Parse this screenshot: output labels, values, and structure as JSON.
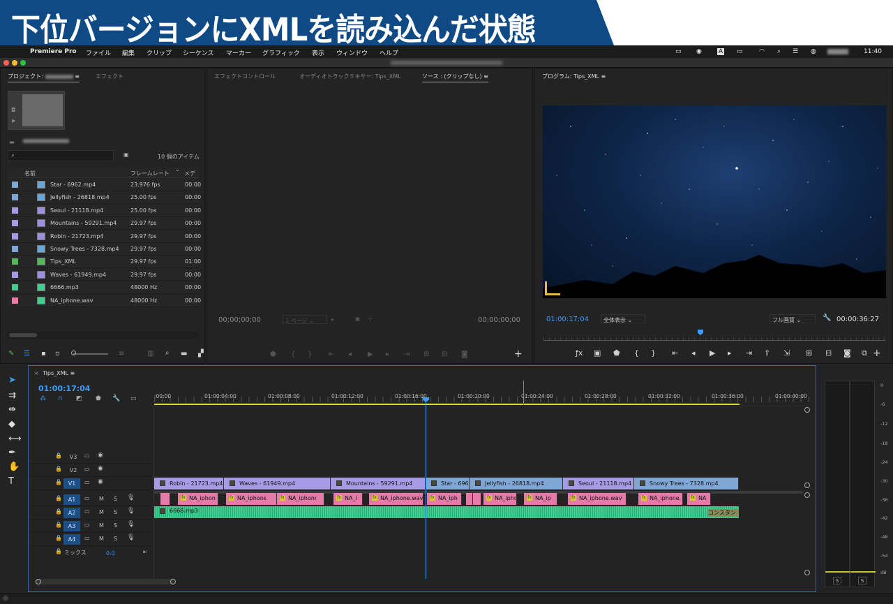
{
  "banner": {
    "title": "下位バージョンにXMLを読み込んだ状態"
  },
  "menubar": {
    "app": "Premiere Pro",
    "items": [
      "ファイル",
      "編集",
      "クリップ",
      "シーケンス",
      "マーカー",
      "グラフィック",
      "表示",
      "ウィンドウ",
      "ヘルプ"
    ],
    "clock": "11:40"
  },
  "project_panel": {
    "tab_project": "プロジェクト:",
    "tab_effects": "エフェクト",
    "item_count": "10 個のアイテム",
    "col_name": "名前",
    "col_framerate": "フレームレート",
    "col_media": "メディ",
    "items": [
      {
        "name": "Star - 6962.mp4",
        "fps": "23.976 fps",
        "start": "00:00",
        "color": "#7fa6d4",
        "icon": "#68a6d8"
      },
      {
        "name": "Jellyfish - 26818.mp4",
        "fps": "25.00 fps",
        "start": "00:00",
        "color": "#7fa6d4",
        "icon": "#68a6d8"
      },
      {
        "name": "Seoul - 21118.mp4",
        "fps": "25.00 fps",
        "start": "00:00",
        "color": "#a79be6",
        "icon": "#9c8fe0"
      },
      {
        "name": "Mountains - 59291.mp4",
        "fps": "29.97 fps",
        "start": "00:00",
        "color": "#a79be6",
        "icon": "#9c8fe0"
      },
      {
        "name": "Robin - 21723.mp4",
        "fps": "29.97 fps",
        "start": "00:00",
        "color": "#a79be6",
        "icon": "#9c8fe0"
      },
      {
        "name": "Snowy Trees - 7328.mp4",
        "fps": "29.97 fps",
        "start": "00:00",
        "color": "#7fa6d4",
        "icon": "#68a6d8"
      },
      {
        "name": "Tips_XML",
        "fps": "29.97 fps",
        "start": "01:00",
        "color": "#4fb85a",
        "icon": "#4fb85a"
      },
      {
        "name": "Waves - 61949.mp4",
        "fps": "29.97 fps",
        "start": "00:00",
        "color": "#a79be6",
        "icon": "#9c8fe0"
      },
      {
        "name": "6666.mp3",
        "fps": "48000 Hz",
        "start": "00:00",
        "color": "#3fcf8e",
        "icon": "#3fcf8e"
      },
      {
        "name": "NA_iphone.wav",
        "fps": "48000 Hz",
        "start": "00:00",
        "color": "#ee7aa8",
        "icon": "#3fcf8e"
      }
    ]
  },
  "source_panel": {
    "tab_effect_controls": "エフェクトコントロール",
    "tab_audio_mixer": "オーディオトラックミキサー: Tips_XML",
    "tab_source": "ソース : (クリップなし)",
    "tc_left": "00;00;00;00",
    "page": "1 ページ",
    "tc_right": "00;00;00;00"
  },
  "program_panel": {
    "tab": "プログラム: Tips_XML",
    "tc_current": "01:00:17:04",
    "zoom": "全体表示",
    "quality": "フル画質",
    "duration": "00:00:36:27"
  },
  "timeline": {
    "tab": "Tips_XML",
    "tc": "01:00:17:04",
    "ruler": [
      ":00:00",
      "01:00:04:00",
      "01:00:08:00",
      "01:00:12:00",
      "01:00:16:00",
      "01:00:20:00",
      "01:00:24:00",
      "01:00:28:00",
      "01:00:32:00",
      "01:00:36:00",
      "01:00:40:00"
    ],
    "video_tracks": [
      "V3",
      "V2",
      "V1"
    ],
    "audio_tracks": [
      "A1",
      "A2",
      "A3",
      "A4"
    ],
    "mix_label": "ミックス",
    "mix_value": "0.0",
    "v1_clips": [
      {
        "name": "Robin - 21723.mp4",
        "color": "#a79be6"
      },
      {
        "name": "Waves - 61949.mp4",
        "color": "#a79be6"
      },
      {
        "name": "Mountains - 59291.mp4",
        "color": "#a79be6"
      },
      {
        "name": "Star - 6962.",
        "color": "#7fa6d4"
      },
      {
        "name": "Jellyfish - 26818.mp4",
        "color": "#7fa6d4"
      },
      {
        "name": "Seoul - 21118.mp4",
        "color": "#a79be6"
      },
      {
        "name": "Snowy Trees - 7328.mp4",
        "color": "#7fa6d4"
      }
    ],
    "a1_clips": [
      "NA_iphon",
      "NA_iphone.",
      "NA_iphone.",
      "NA_i",
      "NA_iphone.wav",
      "NA_iph",
      "NA_ipho",
      "NA_ip",
      "NA_iphone.wav",
      "NA_iphone.",
      "NA"
    ],
    "a2_clip": "6666.mp3",
    "a2_tail": "コンスタン"
  },
  "meter": {
    "labels": [
      "0",
      "-6",
      "-12",
      "-18",
      "-24",
      "-30",
      "-36",
      "-42",
      "-48",
      "-54",
      "dB"
    ],
    "solo": "S"
  }
}
